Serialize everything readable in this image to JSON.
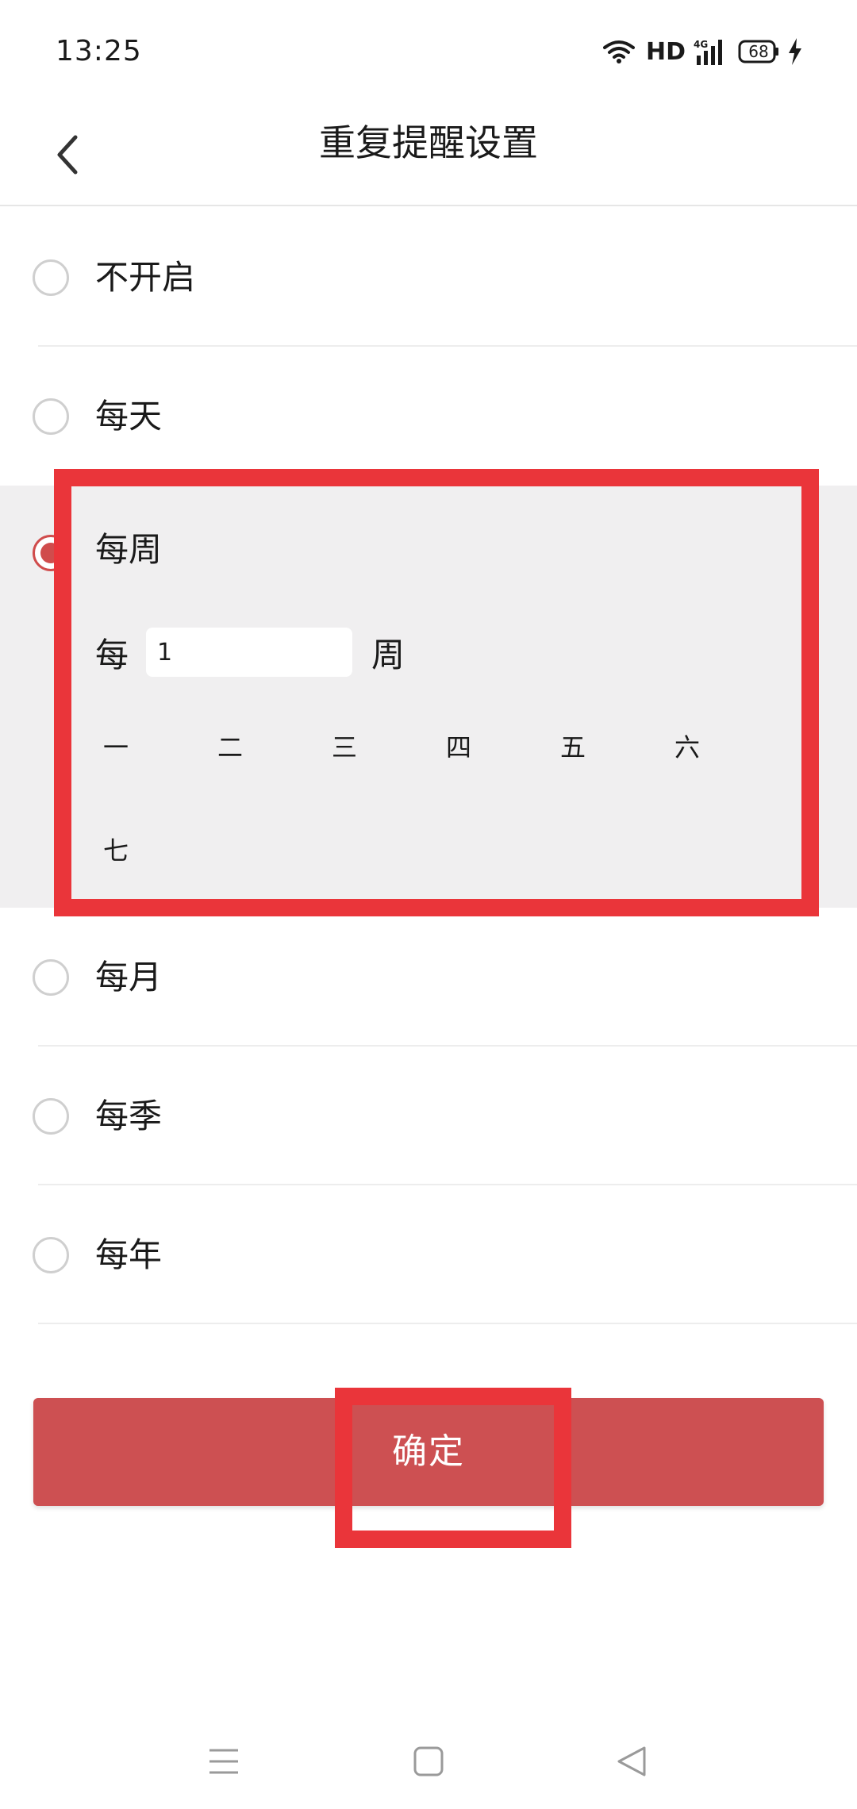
{
  "status_bar": {
    "time": "13:25",
    "network": "HD",
    "signal": "4G",
    "battery": "68"
  },
  "header": {
    "title": "重复提醒设置",
    "back_icon": "chevron-left-icon"
  },
  "options": [
    {
      "label": "不开启",
      "selected": false
    },
    {
      "label": "每天",
      "selected": false
    },
    {
      "label": "每周",
      "selected": true
    },
    {
      "label": "每月",
      "selected": false
    },
    {
      "label": "每季",
      "selected": false
    },
    {
      "label": "每年",
      "selected": false
    }
  ],
  "weekly": {
    "every_prefix": "每",
    "interval_value": "1",
    "every_suffix": "周",
    "days": [
      "一",
      "二",
      "三",
      "四",
      "五",
      "六",
      "七"
    ]
  },
  "confirm_label": "确定",
  "colors": {
    "accent": "#d04c4c",
    "confirm_bg": "#cd5052",
    "highlight": "#ea353a",
    "expanded_bg": "#f0eff0"
  },
  "nav_bar": {
    "icons": [
      "menu-icon",
      "home-square-icon",
      "back-triangle-icon"
    ]
  }
}
